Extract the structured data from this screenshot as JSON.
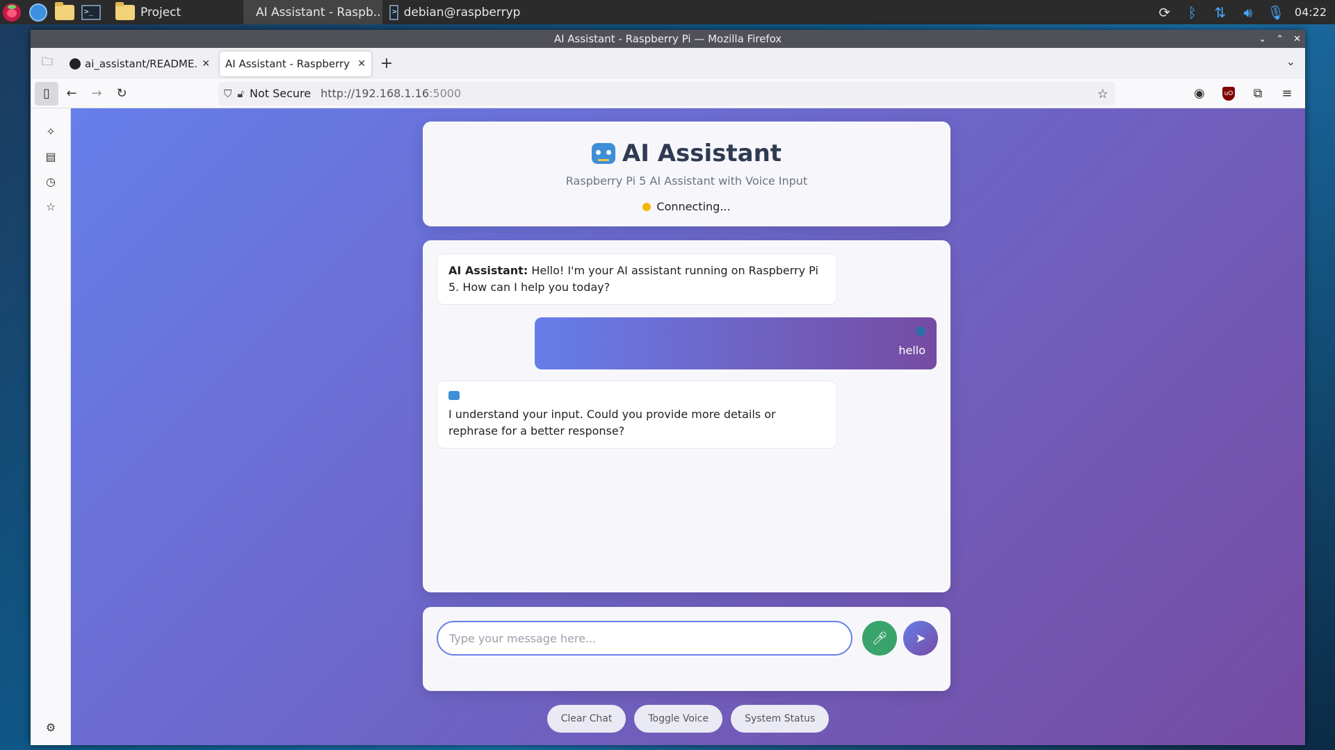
{
  "taskbar": {
    "items": [
      {
        "label": "Project"
      },
      {
        "label": "AI Assistant - Raspb.."
      },
      {
        "label": "debian@raspberrypi:.."
      }
    ],
    "clock": "04:22"
  },
  "window": {
    "title": "AI Assistant - Raspberry Pi — Mozilla Firefox"
  },
  "tabs": [
    {
      "label": "ai_assistant/README.md"
    },
    {
      "label": "AI Assistant - Raspberry Pi"
    }
  ],
  "urlbar": {
    "security_label": "Not Secure",
    "url_host": "http://192.168.1.16",
    "url_port": ":5000"
  },
  "app": {
    "title": "AI Assistant",
    "subtitle": "Raspberry Pi 5 AI Assistant with Voice Input",
    "status": "Connecting...",
    "status_color": "#f5b800",
    "messages": [
      {
        "sender": "AI Assistant:",
        "text": "Hello! I'm your AI assistant running on Raspberry Pi 5. How can I help you today?"
      },
      {
        "text": "hello"
      },
      {
        "text": "I understand your input. Could you provide more details or rephrase for a better response?"
      }
    ],
    "input_placeholder": "Type your message here...",
    "buttons": {
      "clear": "Clear Chat",
      "voice": "Toggle Voice",
      "status": "System Status"
    },
    "colors": {
      "gradient_start": "#667eea",
      "gradient_end": "#764ba2",
      "mic": "#3aa36b"
    }
  }
}
